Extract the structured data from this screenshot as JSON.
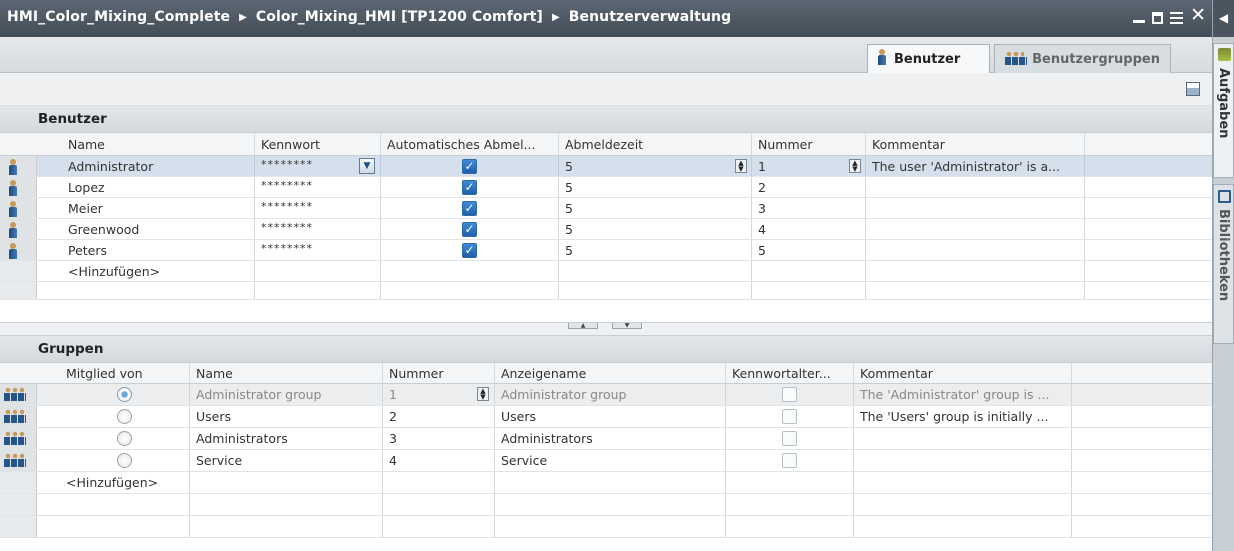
{
  "title": {
    "project": "HMI_Color_Mixing_Complete",
    "device": "Color_Mixing_HMI [TP1200 Comfort]",
    "page": "Benutzerverwaltung",
    "separator": "▶"
  },
  "tabs": {
    "users": "Benutzer",
    "groups": "Benutzergruppen"
  },
  "side_tabs": {
    "tasks": "Aufgaben",
    "libraries": "Bibliotheken"
  },
  "users_section": {
    "heading": "Benutzer",
    "columns": [
      "Name",
      "Kennwort",
      "Automatisches Abmel...",
      "Abmeldezeit",
      "Nummer",
      "Kommentar"
    ],
    "rows": [
      {
        "name": "Administrator",
        "password": "********",
        "auto_logoff": true,
        "logoff_time": "5",
        "number": "1",
        "comment": "The user 'Administrator' is a..."
      },
      {
        "name": "Lopez",
        "password": "********",
        "auto_logoff": true,
        "logoff_time": "5",
        "number": "2",
        "comment": ""
      },
      {
        "name": "Meier",
        "password": "********",
        "auto_logoff": true,
        "logoff_time": "5",
        "number": "3",
        "comment": ""
      },
      {
        "name": "Greenwood",
        "password": "********",
        "auto_logoff": true,
        "logoff_time": "5",
        "number": "4",
        "comment": ""
      },
      {
        "name": "Peters",
        "password": "********",
        "auto_logoff": true,
        "logoff_time": "5",
        "number": "5",
        "comment": ""
      }
    ],
    "add_label": "<Hinzufügen>",
    "selected_row": 0
  },
  "groups_section": {
    "heading": "Gruppen",
    "columns": [
      "Mitglied von",
      "Name",
      "Nummer",
      "Anzeigename",
      "Kennwortalter...",
      "Kommentar"
    ],
    "rows": [
      {
        "member": true,
        "name": "Administrator group",
        "number": "1",
        "display_name": "Administrator group",
        "pw_aging": false,
        "comment": "The 'Administrator' group is ...",
        "disabled": true
      },
      {
        "member": false,
        "name": "Users",
        "number": "2",
        "display_name": "Users",
        "pw_aging": false,
        "comment": "The 'Users' group is initially ...",
        "disabled": false
      },
      {
        "member": false,
        "name": "Administrators",
        "number": "3",
        "display_name": "Administrators",
        "pw_aging": false,
        "comment": "",
        "disabled": false
      },
      {
        "member": false,
        "name": "Service",
        "number": "4",
        "display_name": "Service",
        "pw_aging": false,
        "comment": "",
        "disabled": false
      }
    ],
    "add_label": "<Hinzufügen>"
  },
  "icons": {
    "user": "user-icon",
    "group": "group-icon",
    "checkbox": "checkbox-checked",
    "export": "export-icon",
    "tasks": "tasks-icon",
    "library": "library-icon"
  }
}
